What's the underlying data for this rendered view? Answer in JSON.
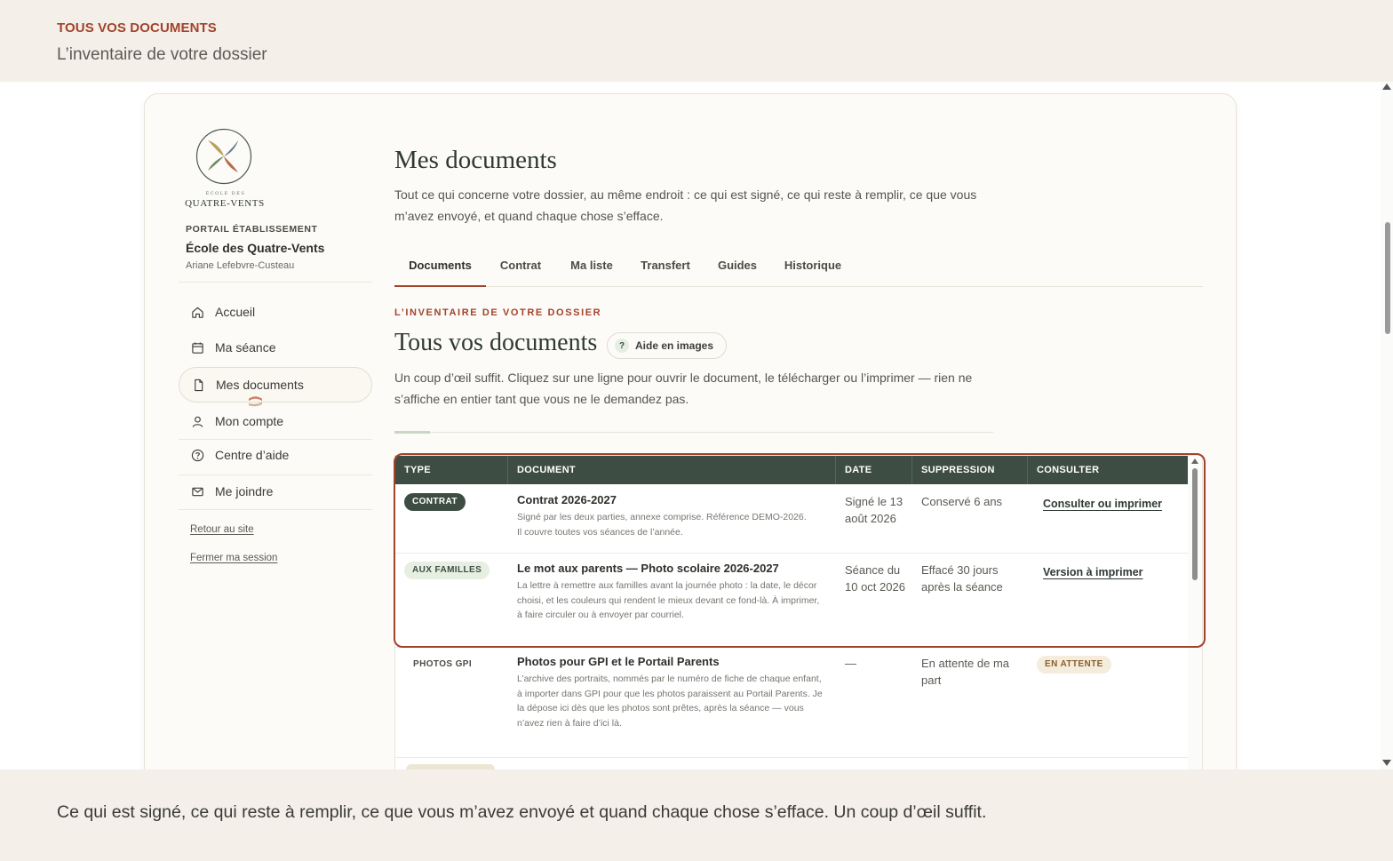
{
  "top_banner": {
    "eyebrow": "TOUS VOS DOCUMENTS",
    "subtitle": "L’inventaire de votre dossier"
  },
  "sidebar": {
    "logo_small": "ÉCOLE DES",
    "logo_name": "QUATRE-VENTS",
    "portal_label": "PORTAIL ÉTABLISSEMENT",
    "school_name": "École des Quatre-Vents",
    "user_name": "Ariane Lefebvre-Custeau",
    "items": [
      {
        "label": "Accueil",
        "icon": "home-icon"
      },
      {
        "label": "Ma séance",
        "icon": "calendar-icon"
      },
      {
        "label": "Mes documents",
        "icon": "document-icon",
        "active": true
      },
      {
        "label": "Mon compte",
        "icon": "user-icon"
      },
      {
        "label": "Centre d’aide",
        "icon": "help-circle-icon"
      },
      {
        "label": "Me joindre",
        "icon": "mail-icon"
      }
    ],
    "links": [
      "Retour au site",
      "Fermer ma session"
    ]
  },
  "main": {
    "title": "Mes documents",
    "description": "Tout ce qui concerne votre dossier, au même endroit : ce qui est signé, ce qui reste à remplir, ce que vous m’avez envoyé, et quand chaque chose s’efface.",
    "tabs": [
      {
        "label": "Documents",
        "active": true
      },
      {
        "label": "Contrat"
      },
      {
        "label": "Ma liste"
      },
      {
        "label": "Transfert"
      },
      {
        "label": "Guides"
      },
      {
        "label": "Historique"
      }
    ],
    "section": {
      "eyebrow": "L’INVENTAIRE DE VOTRE DOSSIER",
      "title": "Tous vos documents",
      "help_button": "Aide en images",
      "help_icon_glyph": "?",
      "description": "Un coup d’œil suffit. Cliquez sur une ligne pour ouvrir le document, le télécharger ou l’imprimer — rien ne s’affiche en entier tant que vous ne le demandez pas."
    }
  },
  "table": {
    "columns": [
      "TYPE",
      "DOCUMENT",
      "DATE",
      "SUPPRESSION",
      "CONSULTER"
    ],
    "rows": [
      {
        "type": "CONTRAT",
        "title": "Contrat 2026-2027",
        "desc": "Signé par les deux parties, annexe comprise. Référence DEMO-2026. Il couvre toutes vos séances de l’année.",
        "date": "Signé le 13 août 2026",
        "suppression": "Conservé 6 ans",
        "action": "Consulter ou imprimer"
      },
      {
        "type": "AUX FAMILLES",
        "title": "Le mot aux parents — Photo scolaire 2026-2027",
        "desc": "La lettre à remettre aux familles avant la journée photo : la date, le décor choisi, et les couleurs qui rendent le mieux devant ce fond-là. À imprimer, à faire circuler ou à envoyer par courriel.",
        "date": "Séance du 10 oct 2026",
        "suppression": "Effacé 30 jours après la séance",
        "action": "Version à imprimer"
      },
      {
        "type": "PHOTOS GPI",
        "title": "Photos pour GPI et le Portail Parents",
        "desc": "L’archive des portraits, nommés par le numéro de fiche de chaque enfant, à importer dans GPI pour que les photos paraissent au Portail Parents. Je la dépose ici dès que les photos sont prêtes, après la séance — vous n’avez rien à faire d’ici là.",
        "date": "—",
        "suppression": "En attente de ma part",
        "status": "EN ATTENTE"
      }
    ]
  },
  "bottom_banner": {
    "text": "Ce qui est signé, ce qui reste à remplir, ce que vous m’avez envoyé et quand chaque chose s’efface. Un coup d’œil suffit."
  },
  "colors": {
    "accent": "#a2432b",
    "header_green": "#3e4d44",
    "background": "#f4efe9"
  }
}
